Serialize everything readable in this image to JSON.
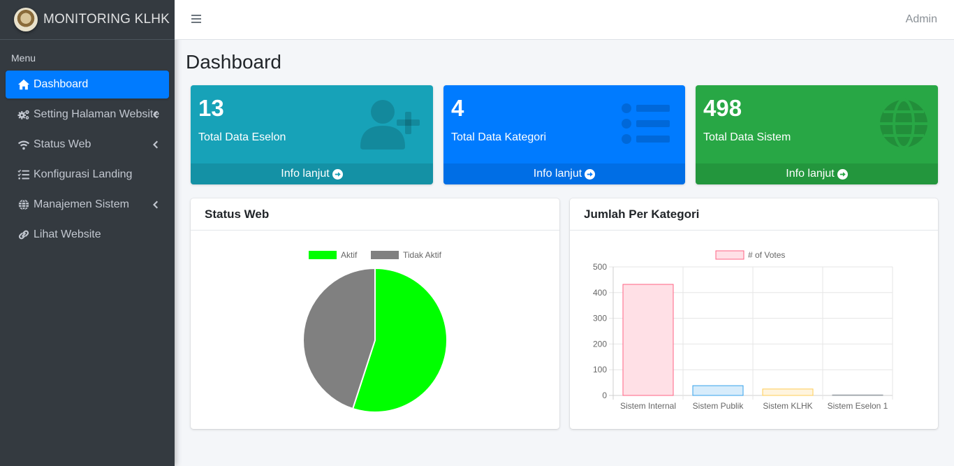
{
  "brand": {
    "title": "MONITORING KLHK"
  },
  "sidebar": {
    "header": "Menu",
    "items": [
      {
        "label": "Dashboard",
        "icon": "home-icon",
        "active": true,
        "has_chevron": false
      },
      {
        "label": "Setting Halaman Website",
        "icon": "cogs-icon",
        "active": false,
        "has_chevron": true
      },
      {
        "label": "Status Web",
        "icon": "wifi-icon",
        "active": false,
        "has_chevron": true
      },
      {
        "label": "Konfigurasi Landing",
        "icon": "list-check-icon",
        "active": false,
        "has_chevron": false
      },
      {
        "label": "Manajemen Sistem",
        "icon": "globe-icon",
        "active": false,
        "has_chevron": true
      },
      {
        "label": "Lihat Website",
        "icon": "link-icon",
        "active": false,
        "has_chevron": false
      }
    ]
  },
  "topbar": {
    "user": "Admin"
  },
  "page": {
    "title": "Dashboard"
  },
  "stats": [
    {
      "number": "13",
      "label": "Total Data Eselon",
      "footer": "Info lanjut",
      "color": "#17a2b8",
      "icon": "user-plus-icon"
    },
    {
      "number": "4",
      "label": "Total Data Kategori",
      "footer": "Info lanjut",
      "color": "#007bff",
      "icon": "list-icon"
    },
    {
      "number": "498",
      "label": "Total Data Sistem",
      "footer": "Info lanjut",
      "color": "#28a745",
      "icon": "globe-icon"
    }
  ],
  "cards": {
    "status_web": {
      "title": "Status Web"
    },
    "jumlah_kategori": {
      "title": "Jumlah Per Kategori"
    }
  },
  "chart_data": [
    {
      "type": "pie",
      "title": "",
      "labels": [
        "Aktif",
        "Tidak Aktif"
      ],
      "values": [
        55,
        45
      ],
      "colors": [
        "#00ff00",
        "#808080"
      ],
      "legend": "top"
    },
    {
      "type": "bar",
      "title": "",
      "categories": [
        "Sistem Internal",
        "Sistem Publik",
        "Sistem KLHK",
        "Sistem Eselon 1"
      ],
      "series": [
        {
          "name": "# of Votes",
          "values": [
            432,
            38,
            25,
            2
          ]
        }
      ],
      "bar_fills": [
        "#ffe0e6",
        "#d7ecfb",
        "#fff4de",
        "#e7e9ed"
      ],
      "bar_strokes": [
        "#ff6384",
        "#36a2eb",
        "#ffce56",
        "#9aa0a6"
      ],
      "ylim": [
        0,
        500
      ],
      "yticks": [
        0,
        100,
        200,
        300,
        400,
        500
      ],
      "grid": true,
      "legend": "top"
    }
  ]
}
